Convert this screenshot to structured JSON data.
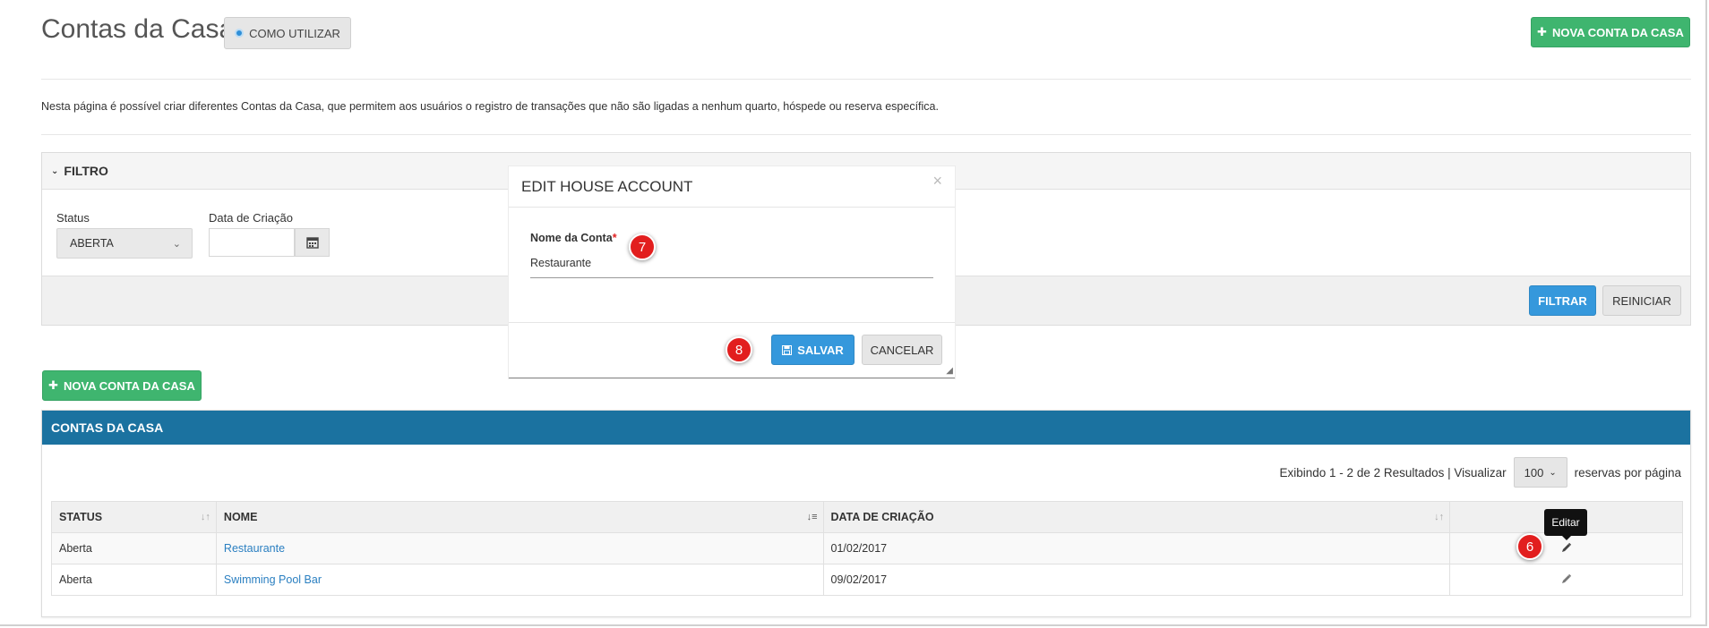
{
  "page": {
    "title": "Contas da Casa",
    "help_button": "COMO UTILIZAR",
    "new_button": "NOVA CONTA DA CASA",
    "description": "Nesta página é possível criar diferentes Contas da Casa, que permitem aos usuários o registro de transações que não são ligadas a nenhum quarto, hóspede ou reserva específica."
  },
  "filter": {
    "title": "FILTRO",
    "status_label": "Status",
    "status_value": "ABERTA",
    "date_label": "Data de Criação",
    "date_value": "",
    "filter_button": "FILTRAR",
    "reset_button": "REINICIAR"
  },
  "list": {
    "new_button": "NOVA CONTA DA CASA",
    "title": "CONTAS DA CASA",
    "pager_text": "Exibindo 1 - 2 de 2 Resultados | Visualizar",
    "page_size": "100",
    "pager_suffix": "reservas por página",
    "columns": [
      "STATUS",
      "NOME",
      "DATA DE CRIAÇÃO",
      ""
    ],
    "rows": [
      {
        "status": "Aberta",
        "name": "Restaurante",
        "date": "01/02/2017"
      },
      {
        "status": "Aberta",
        "name": "Swimming Pool Bar",
        "date": "09/02/2017"
      }
    ],
    "edit_tooltip": "Editar"
  },
  "modal": {
    "title": "EDIT HOUSE ACCOUNT",
    "field_label": "Nome da Conta",
    "required_mark": "*",
    "field_value": "Restaurante",
    "save_button": "SALVAR",
    "cancel_button": "CANCELAR"
  },
  "badges": {
    "six": "6",
    "seven": "7",
    "eight": "8"
  },
  "colors": {
    "accent_green": "#3fb56f",
    "accent_blue": "#3598dc",
    "header_blue": "#1b72a0",
    "badge_red": "#e21e1e",
    "link": "#2a7fc1"
  }
}
